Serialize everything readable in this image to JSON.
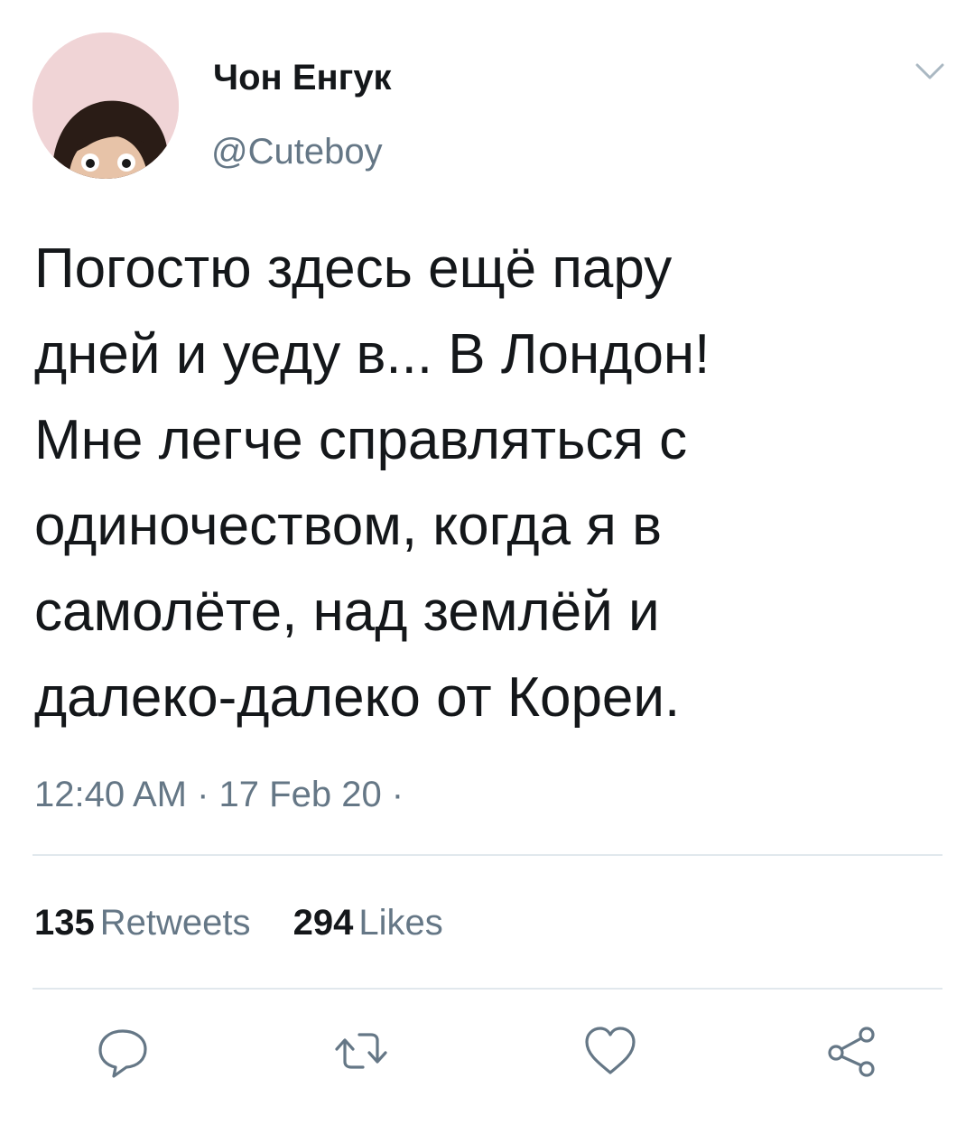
{
  "user": {
    "display_name": "Чон Енгук",
    "handle": "@Cuteboy",
    "avatar_icon": "avatar-photo"
  },
  "tweet": {
    "text": "Погостю здесь ещё пару\nдней и уеду в... В Лондон!\nМне легче справляться с\nодиночеством, когда я в\nсамолёте, над землёй и\nдалеко-далеко от Кореи.",
    "timestamp": "12:40 AM · 17 Feb 20 ·"
  },
  "stats": {
    "retweets_count": "135",
    "retweets_label": "Retweets",
    "likes_count": "294",
    "likes_label": "Likes"
  },
  "actions": [
    {
      "name": "reply",
      "icon": "reply-icon"
    },
    {
      "name": "retweet",
      "icon": "retweet-icon"
    },
    {
      "name": "like",
      "icon": "heart-icon"
    },
    {
      "name": "share",
      "icon": "share-icon"
    }
  ],
  "colors": {
    "text_primary": "#14171a",
    "text_secondary": "#657786",
    "divider": "#e1e8ed",
    "icon": "#657786"
  }
}
